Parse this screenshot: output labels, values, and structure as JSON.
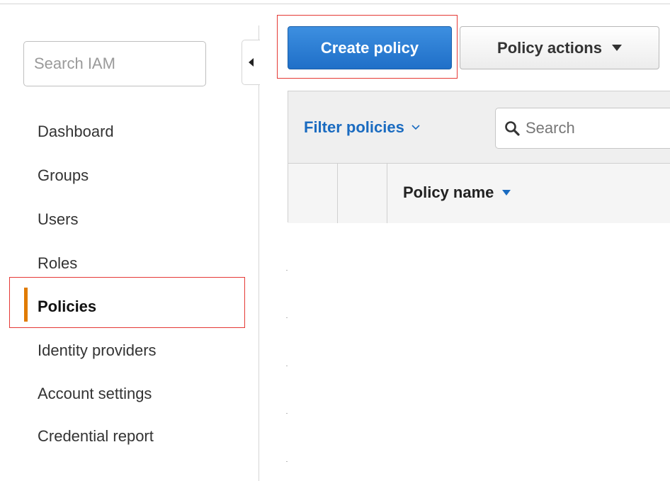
{
  "sidebar": {
    "search_placeholder": "Search IAM",
    "items": [
      {
        "label": "Dashboard"
      },
      {
        "label": "Groups"
      },
      {
        "label": "Users"
      },
      {
        "label": "Roles"
      },
      {
        "label": "Policies",
        "active": true
      },
      {
        "label": "Identity providers"
      },
      {
        "label": "Account settings"
      },
      {
        "label": "Credential report"
      }
    ]
  },
  "toolbar": {
    "create_label": "Create policy",
    "actions_label": "Policy actions"
  },
  "table": {
    "filter_label": "Filter policies",
    "search_placeholder": "Search",
    "columns": [
      "Policy name"
    ]
  },
  "colors": {
    "primary_button": "#1f6fc8",
    "link": "#1a6bc0",
    "active_indicator": "#e07b00",
    "highlight_box": "#e53935"
  }
}
